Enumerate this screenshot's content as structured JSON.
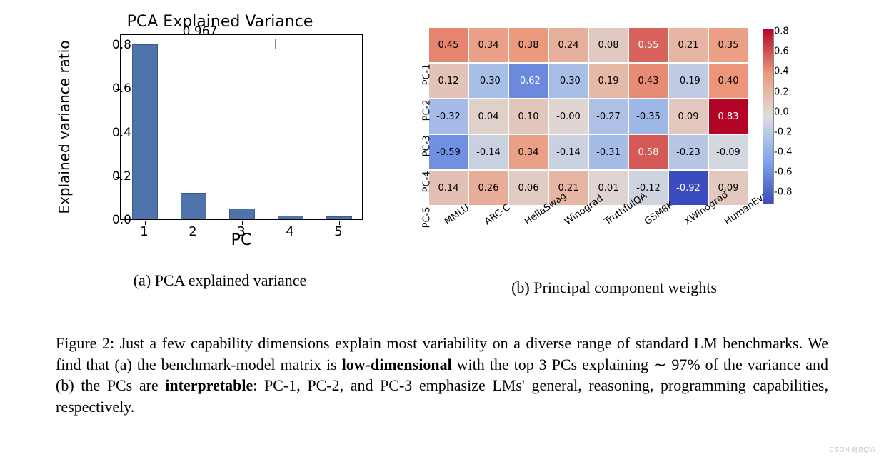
{
  "chart_data": [
    {
      "type": "bar",
      "title": "PCA Explained Variance",
      "xlabel": "PC",
      "ylabel": "Explained variance ratio",
      "categories": [
        "1",
        "2",
        "3",
        "4",
        "5"
      ],
      "values": [
        0.8,
        0.12,
        0.05,
        0.015,
        0.012
      ],
      "ylim": [
        0.0,
        0.85
      ],
      "yticks": [
        0.0,
        0.2,
        0.4,
        0.6,
        0.8
      ],
      "annotation": {
        "label": "0.967",
        "span": [
          1,
          3
        ]
      }
    },
    {
      "type": "heatmap",
      "rows": [
        "PC-1",
        "PC-2",
        "PC-3",
        "PC-4",
        "PC-5"
      ],
      "cols": [
        "MMLU",
        "ARC-C",
        "HellaSwag",
        "Winograd",
        "TruthfulQA",
        "GSM8K",
        "XWinograd",
        "HumanEval"
      ],
      "values": [
        [
          0.45,
          0.34,
          0.38,
          0.24,
          0.08,
          0.55,
          0.21,
          0.35
        ],
        [
          0.12,
          -0.3,
          -0.62,
          -0.3,
          0.19,
          0.43,
          -0.19,
          0.4
        ],
        [
          -0.32,
          0.04,
          0.1,
          -0.0,
          -0.27,
          -0.35,
          0.09,
          0.83
        ],
        [
          -0.59,
          -0.14,
          0.34,
          -0.14,
          -0.31,
          0.58,
          -0.23,
          -0.09
        ],
        [
          0.14,
          0.26,
          0.06,
          0.21,
          0.01,
          -0.12,
          -0.92,
          0.09
        ]
      ],
      "vmin": -0.92,
      "vmax": 0.83,
      "cbar_ticks": [
        -0.8,
        -0.6,
        -0.4,
        -0.2,
        0.0,
        0.2,
        0.4,
        0.6,
        0.8
      ]
    }
  ],
  "subcaptions": {
    "a": "(a) PCA explained variance",
    "b": "(b) Principal component weights"
  },
  "caption": {
    "prefix": "Figure 2: Just a few capability dimensions explain most variability on a diverse range of standard LM benchmarks. We find that (a) the benchmark-model matrix is ",
    "bold1": "low-dimensional",
    "mid1": " with the top 3 PCs explaining ∼ 97% of the variance and (b) the PCs are ",
    "bold2": "interpretable",
    "suffix": ": PC-1, PC-2, and PC-3 emphasize LMs' general, reasoning, programming capabilities, respectively."
  },
  "watermark": "CSDN @BQW_"
}
